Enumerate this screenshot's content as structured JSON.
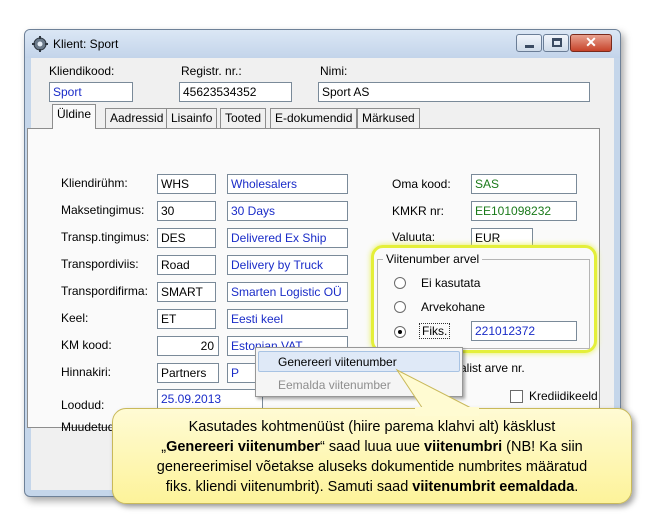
{
  "window": {
    "title": "Klient: Sport",
    "close_glyph": "✕"
  },
  "header": {
    "client_code_label": "Kliendikood:",
    "client_code_value": "Sport",
    "reg_no_label": "Registr. nr.:",
    "reg_no_value": "45623534352",
    "name_label": "Nimi:",
    "name_value": "Sport AS"
  },
  "tabs": [
    "Üldine",
    "Aadressid",
    "Lisainfo",
    "Tooted",
    "E-dokumendid",
    "Märkused"
  ],
  "general": {
    "rows": [
      {
        "label": "Kliendirühm:",
        "code": "WHS",
        "desc": "Wholesalers"
      },
      {
        "label": "Maksetingimus:",
        "code": "30",
        "desc": "30 Days"
      },
      {
        "label": "Transp.tingimus:",
        "code": "DES",
        "desc": "Delivered Ex Ship"
      },
      {
        "label": "Transpordiviis:",
        "code": "Road",
        "desc": "Delivery by Truck"
      },
      {
        "label": "Transpordifirma:",
        "code": "SMART",
        "desc": "Smarten Logistic OÜ"
      },
      {
        "label": "Keel:",
        "code": "ET",
        "desc": "Eesti keel"
      },
      {
        "label": "KM kood:",
        "code": "20",
        "desc": "Estonian VAT"
      },
      {
        "label": "Hinnakiri:",
        "code": "Partners",
        "desc": "P"
      }
    ],
    "loodud_label": "Loodud:",
    "loodud_value": "25.09.2013",
    "muudetud_label": "Muudetud:"
  },
  "right": {
    "own_code_label": "Oma kood:",
    "own_code_value": "SAS",
    "vat_no_label": "KMKR nr:",
    "vat_no_value": "EE101098232",
    "currency_label": "Valuuta:",
    "currency_value": "EUR",
    "ref_group_label": "Viitenumber arvel",
    "opt_none": "Ei kasutata",
    "opt_invoice": "Arvekohane",
    "opt_fixed": "Fiks.",
    "fixed_value": "221012372",
    "partial_label": "alist arve nr.",
    "credit_label": "Krediidikeeld"
  },
  "context_menu": {
    "generate": "Genereeri viitenumber",
    "remove": "Eemalda viitenumber"
  },
  "callout": {
    "l1": "Kasutades kohtmenüüst (hiire parema klahvi alt) käsklust",
    "l2a": "„",
    "l2b": "Genereeri viitenumber",
    "l2c": "“ saad luua uue ",
    "l2d": "viitenumbri",
    "l2e": "  (NB! Ka siin",
    "l3": "genereerimisel võetakse aluseks  dokumentide numbrites määratud",
    "l4a": "fiks. kliendi viitenumbrit).  Samuti saad ",
    "l4b": "viitenumbrit eemaldada",
    "l4c": "."
  }
}
